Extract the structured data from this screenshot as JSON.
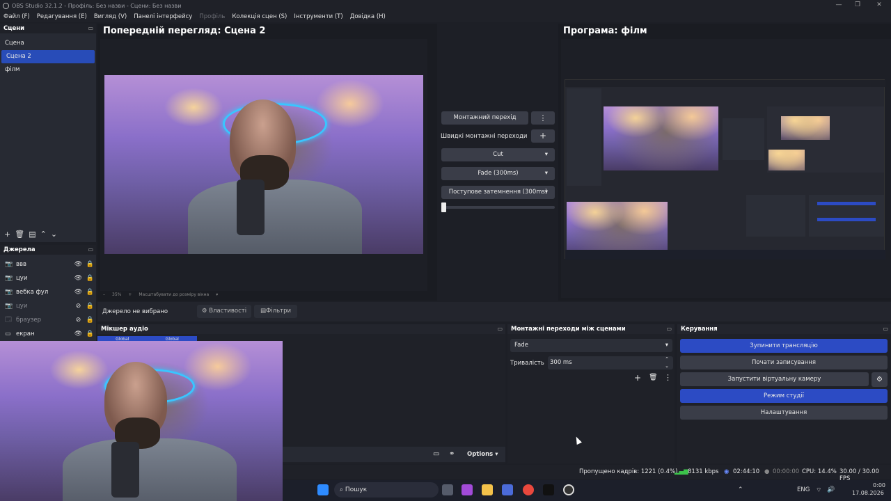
{
  "titlebar": {
    "title": "OBS Studio 32.1.2 - Профіль: Без назви - Сцени: Без назви"
  },
  "menu": [
    {
      "label": "Файл (F)",
      "dim": false
    },
    {
      "label": "Редагування (E)",
      "dim": false
    },
    {
      "label": "Вигляд (V)",
      "dim": false
    },
    {
      "label": "Панелі інтерфейсу",
      "dim": false
    },
    {
      "label": "Профіль",
      "dim": true
    },
    {
      "label": "Колекція сцен (S)",
      "dim": false
    },
    {
      "label": "Інструменти (T)",
      "dim": false
    },
    {
      "label": "Довідка (H)",
      "dim": false
    }
  ],
  "scenes": {
    "header": "Сцени",
    "items": [
      {
        "label": "Сцена",
        "selected": false
      },
      {
        "label": "Сцена 2",
        "selected": true
      },
      {
        "label": "філм",
        "selected": false
      }
    ]
  },
  "sources": {
    "header": "Джерела",
    "items": [
      {
        "label": "ввв",
        "icon": "camera-icon",
        "visible": true
      },
      {
        "label": "цуи",
        "icon": "camera-icon",
        "visible": true
      },
      {
        "label": "вебка фул",
        "icon": "camera-icon",
        "visible": true
      },
      {
        "label": "цуи",
        "icon": "camera-icon",
        "visible": false
      },
      {
        "label": "браузер",
        "icon": "browser-icon",
        "visible": false
      },
      {
        "label": "екран",
        "icon": "monitor-icon",
        "visible": true
      }
    ]
  },
  "preview": {
    "title": "Попередній перегляд: Сцена 2",
    "zoom": "35%",
    "fit_label": "Масштабувати до розміру вікна"
  },
  "program": {
    "title": "Програма: філм"
  },
  "transition_center": {
    "transition_button": "Монтажний перехід",
    "quick_label": "Швидкі монтажні переходи",
    "quick": [
      "Cut",
      "Fade (300ms)",
      "Поступове затемнення (300ms)"
    ]
  },
  "source_bar": {
    "no_source": "Джерело не вибрано",
    "properties": "Властивості",
    "filters": "Фільтри"
  },
  "mixer": {
    "header": "Мікшер аудіо",
    "labels": [
      "Global",
      "Global"
    ],
    "options": "Options"
  },
  "transitions_dock": {
    "header": "Монтажні переходи між сценами",
    "selected": "Fade",
    "duration_label": "Тривалість",
    "duration_value": "300 ms"
  },
  "controls": {
    "header": "Керування",
    "buttons": [
      {
        "label": "Зупинити трансляцію",
        "active": true
      },
      {
        "label": "Почати записування",
        "active": false
      },
      {
        "label": "Запустити віртуальну камеру",
        "active": false
      },
      {
        "label": "Режим студії",
        "active": true
      },
      {
        "label": "Налаштування",
        "active": false
      }
    ]
  },
  "status": {
    "dropped": "Пропущено кадрів: 1221 (0.4%)",
    "bitrate": "8131 kbps",
    "stream_time": "02:44:10",
    "rec_time": "00:00:00",
    "cpu": "CPU: 14.4%",
    "fps": "30.00 / 30.00 FPS"
  },
  "taskbar": {
    "search": "Пошук",
    "lang": "ENG",
    "time": "0:00",
    "date": "17.08.2026"
  },
  "colors": {
    "accent": "#2c4bc4",
    "background": "#1d1f26",
    "panel": "#272a33"
  }
}
